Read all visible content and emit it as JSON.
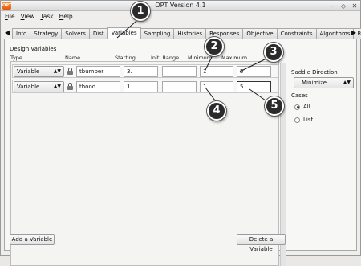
{
  "window": {
    "title": "OPT Version 4.1",
    "app_icon_text": "OPT"
  },
  "menu": [
    {
      "key": "F",
      "rest": "ile"
    },
    {
      "key": "V",
      "rest": "iew"
    },
    {
      "key": "T",
      "rest": "ask"
    },
    {
      "key": "H",
      "rest": "elp"
    }
  ],
  "tabs": [
    "Info",
    "Strategy",
    "Solvers",
    "Dist",
    "Variables",
    "Sampling",
    "Histories",
    "Responses",
    "Objective",
    "Constraints",
    "Algorithms",
    "Run"
  ],
  "active_tab": "Variables",
  "design_variables": {
    "section_title": "Design Variables",
    "columns": {
      "type": "Type",
      "name": "Name",
      "starting": "Starting",
      "init_range": "Init. Range",
      "minimum": "Minimum",
      "maximum": "Maximum"
    },
    "rows": [
      {
        "type": "Variable",
        "name": "tbumper",
        "starting": "3.",
        "init_range": "",
        "minimum": "1",
        "maximum": "5"
      },
      {
        "type": "Variable",
        "name": "thood",
        "starting": "1.",
        "init_range": "",
        "minimum": "1",
        "maximum": "5"
      }
    ],
    "add_button": "Add a Variable",
    "delete_button": "Delete a Variable"
  },
  "saddle_direction": {
    "label": "Saddle Direction",
    "value": "Minimize"
  },
  "cases": {
    "label": "Cases",
    "options": [
      "All",
      "List"
    ],
    "selected": "All"
  },
  "callouts": [
    "1",
    "2",
    "3",
    "4",
    "5"
  ],
  "icons": {
    "lock": "lock-icon",
    "left_arrow": "tab-scroll-left-icon",
    "right_arrow": "tab-scroll-right-icon"
  }
}
